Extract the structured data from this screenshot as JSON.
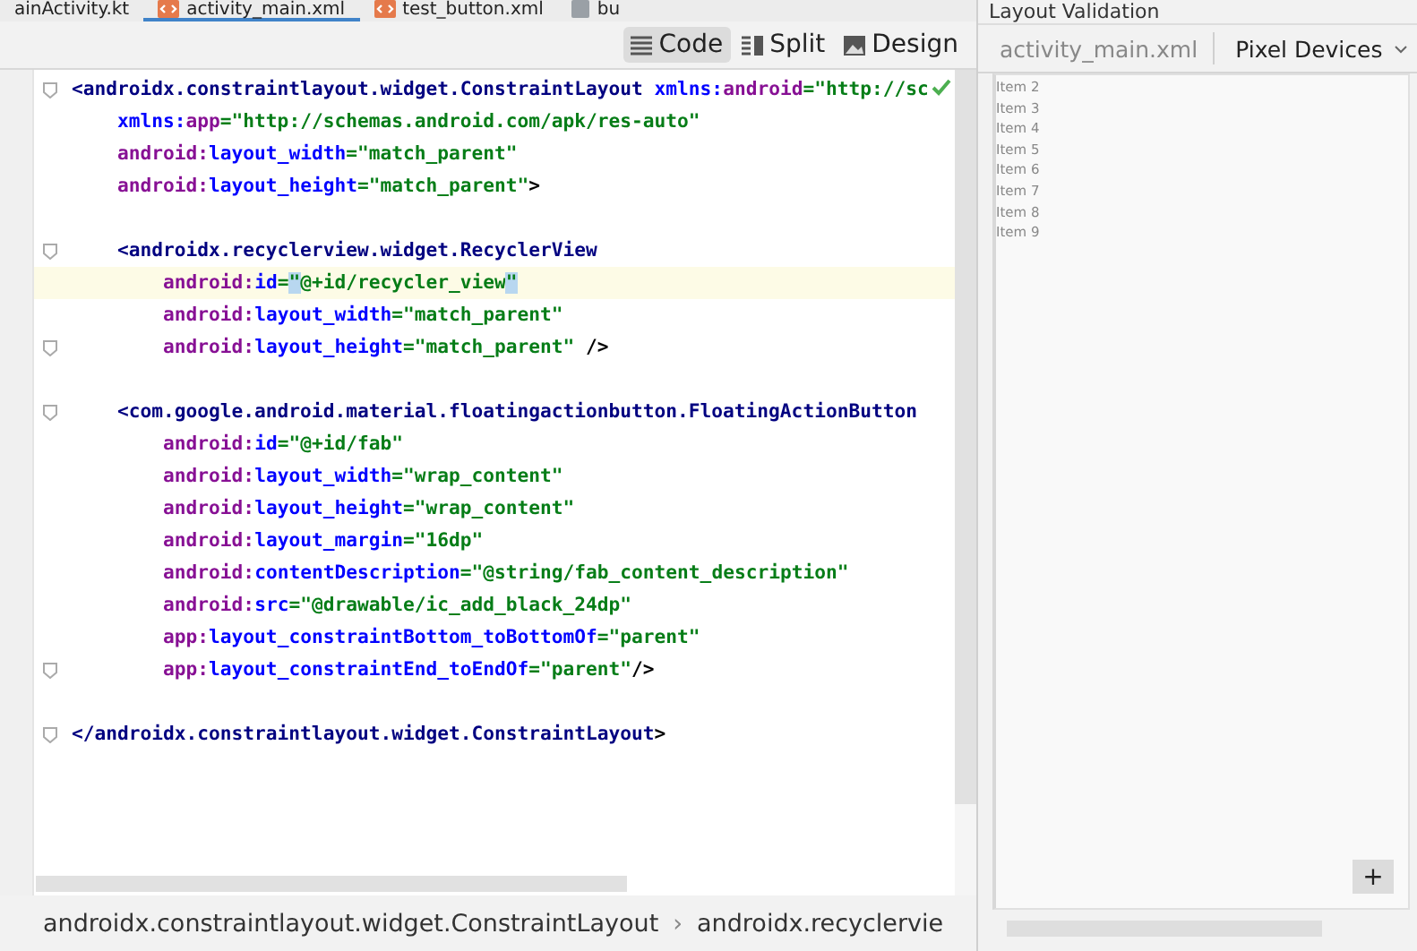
{
  "file_tabs": [
    {
      "label": "ainActivity.kt",
      "kind": "kotlin",
      "selected": false
    },
    {
      "label": "activity_main.xml",
      "kind": "xml",
      "selected": true
    },
    {
      "label": "test_button.xml",
      "kind": "xml",
      "selected": false
    },
    {
      "label": "bu",
      "kind": "other",
      "selected": false
    }
  ],
  "view_modes": [
    {
      "label": "Code",
      "kind": "code",
      "selected": true
    },
    {
      "label": "Split",
      "kind": "split",
      "selected": false
    },
    {
      "label": "Design",
      "kind": "design",
      "selected": false
    }
  ],
  "code_lines": [
    {
      "current": false,
      "fold": true,
      "tokens": [
        {
          "t": "<androidx.constraintlayout.widget.ConstraintLayout ",
          "kind": "tag"
        },
        {
          "t": "xmlns:",
          "kind": "attr"
        },
        {
          "t": "android",
          "kind": "ns"
        },
        {
          "t": "=\"http://sc",
          "kind": "value"
        }
      ]
    },
    {
      "current": false,
      "fold": false,
      "tokens": [
        {
          "t": "    xmlns:",
          "kind": "attr"
        },
        {
          "t": "app",
          "kind": "ns"
        },
        {
          "t": "=\"http://schemas.android.com/apk/res-auto\"",
          "kind": "value"
        }
      ]
    },
    {
      "current": false,
      "fold": false,
      "tokens": [
        {
          "t": "    android:",
          "kind": "ns"
        },
        {
          "t": "layout_width",
          "kind": "attr"
        },
        {
          "t": "=\"match_parent\"",
          "kind": "value"
        }
      ]
    },
    {
      "current": false,
      "fold": false,
      "tokens": [
        {
          "t": "    android:",
          "kind": "ns"
        },
        {
          "t": "layout_height",
          "kind": "attr"
        },
        {
          "t": "=\"match_parent\"",
          "kind": "value"
        },
        {
          "t": ">",
          "kind": "punct"
        }
      ]
    },
    {
      "current": false,
      "fold": false
    },
    {
      "current": false,
      "fold": true,
      "tokens": [
        {
          "t": "    <androidx.recyclerview.widget.RecyclerView",
          "kind": "tag"
        }
      ]
    },
    {
      "current": true,
      "fold": false,
      "tokens": [
        {
          "t": "        android:",
          "kind": "ns"
        },
        {
          "t": "id",
          "kind": "attr"
        },
        {
          "t": "=",
          "kind": "value"
        },
        {
          "t": "\"",
          "kind": "match"
        },
        {
          "t": "@+id/recycler_view",
          "kind": "value"
        },
        {
          "t": "\"",
          "kind": "match"
        }
      ]
    },
    {
      "current": false,
      "fold": false,
      "tokens": [
        {
          "t": "        android:",
          "kind": "ns"
        },
        {
          "t": "layout_width",
          "kind": "attr"
        },
        {
          "t": "=\"match_parent\"",
          "kind": "value"
        }
      ]
    },
    {
      "current": false,
      "fold": true,
      "tokens": [
        {
          "t": "        android:",
          "kind": "ns"
        },
        {
          "t": "layout_height",
          "kind": "attr"
        },
        {
          "t": "=\"match_parent\"",
          "kind": "value"
        },
        {
          "t": " />",
          "kind": "punct"
        }
      ]
    },
    {
      "current": false,
      "fold": false
    },
    {
      "current": false,
      "fold": true,
      "tokens": [
        {
          "t": "    <com.google.android.material.floatingactionbutton.FloatingActionButton",
          "kind": "tag"
        }
      ]
    },
    {
      "current": false,
      "fold": false,
      "tokens": [
        {
          "t": "        android:",
          "kind": "ns"
        },
        {
          "t": "id",
          "kind": "attr"
        },
        {
          "t": "=\"@+id/fab\"",
          "kind": "value"
        }
      ]
    },
    {
      "current": false,
      "fold": false,
      "tokens": [
        {
          "t": "        android:",
          "kind": "ns"
        },
        {
          "t": "layout_width",
          "kind": "attr"
        },
        {
          "t": "=\"wrap_content\"",
          "kind": "value"
        }
      ]
    },
    {
      "current": false,
      "fold": false,
      "tokens": [
        {
          "t": "        android:",
          "kind": "ns"
        },
        {
          "t": "layout_height",
          "kind": "attr"
        },
        {
          "t": "=\"wrap_content\"",
          "kind": "value"
        }
      ]
    },
    {
      "current": false,
      "fold": false,
      "tokens": [
        {
          "t": "        android:",
          "kind": "ns"
        },
        {
          "t": "layout_margin",
          "kind": "attr"
        },
        {
          "t": "=\"16dp\"",
          "kind": "value"
        }
      ]
    },
    {
      "current": false,
      "fold": false,
      "tokens": [
        {
          "t": "        android:",
          "kind": "ns"
        },
        {
          "t": "contentDescription",
          "kind": "attr"
        },
        {
          "t": "=\"@string/fab_content_description\"",
          "kind": "value"
        }
      ]
    },
    {
      "current": false,
      "fold": false,
      "tokens": [
        {
          "t": "        android:",
          "kind": "ns"
        },
        {
          "t": "src",
          "kind": "attr"
        },
        {
          "t": "=\"@drawable/ic_add_black_24dp\"",
          "kind": "value"
        }
      ]
    },
    {
      "current": false,
      "fold": false,
      "tokens": [
        {
          "t": "        app:",
          "kind": "ns"
        },
        {
          "t": "layout_constraintBottom_toBottomOf",
          "kind": "attr"
        },
        {
          "t": "=\"parent\"",
          "kind": "value"
        }
      ]
    },
    {
      "current": false,
      "fold": true,
      "tokens": [
        {
          "t": "        app:",
          "kind": "ns"
        },
        {
          "t": "layout_constraintEnd_toEndOf",
          "kind": "attr"
        },
        {
          "t": "=\"parent\"",
          "kind": "value"
        },
        {
          "t": "/>",
          "kind": "punct"
        }
      ]
    },
    {
      "current": false,
      "fold": false
    },
    {
      "current": false,
      "fold": true,
      "tokens": [
        {
          "t": "</androidx.constraintlayout.widget.ConstraintLayout",
          "kind": "tag"
        },
        {
          "t": ">",
          "kind": "punct"
        }
      ]
    }
  ],
  "breadcrumbs": [
    "androidx.constraintlayout.widget.ConstraintLayout",
    "androidx.recyclervie"
  ],
  "breadcrumb_separator": "›",
  "validation": {
    "title": "Layout Validation",
    "file": "activity_main.xml",
    "device": "Pixel Devices",
    "items": [
      "Item 2",
      "Item 3",
      "Item 4",
      "Item 5",
      "Item 6",
      "Item 7",
      "Item 8",
      "Item 9"
    ],
    "fab": "+"
  }
}
